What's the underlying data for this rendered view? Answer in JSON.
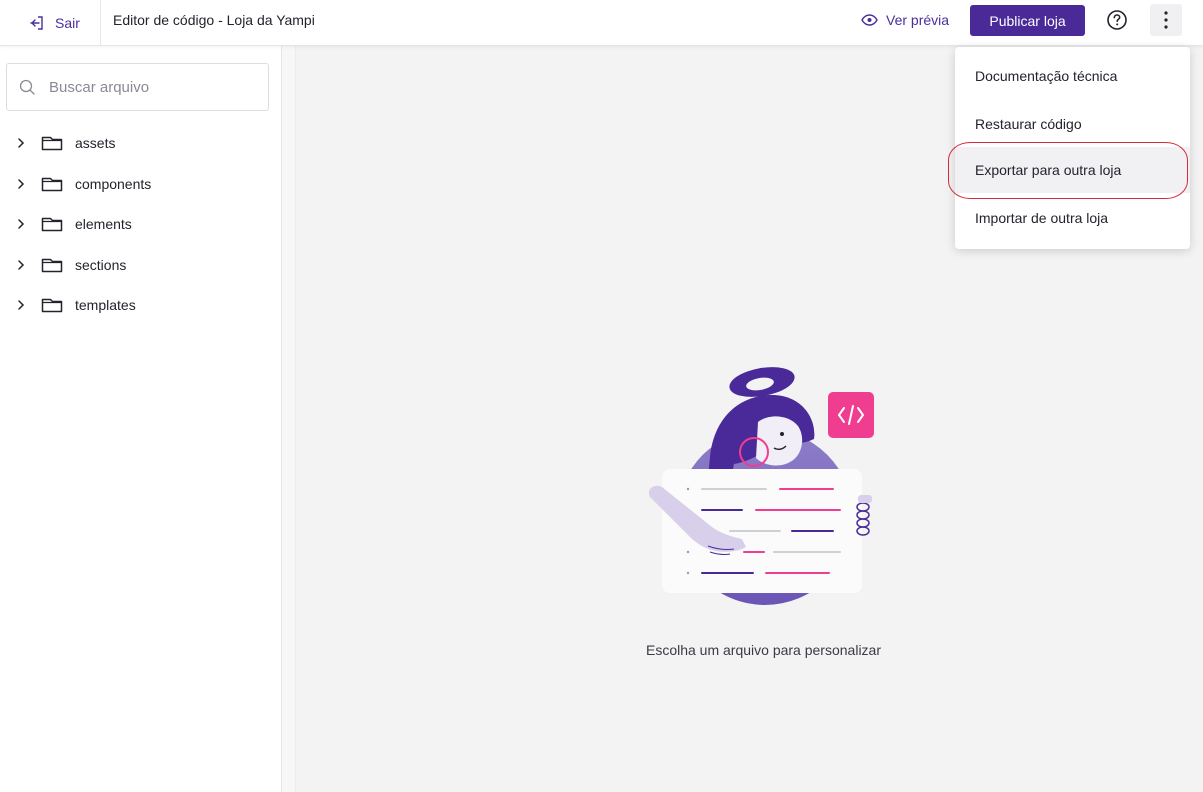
{
  "topbar": {
    "exit_label": "Sair",
    "title": "Editor de código - Loja da Yampi",
    "preview_label": "Ver prévia",
    "publish_label": "Publicar loja"
  },
  "sidebar": {
    "search": {
      "placeholder": "Buscar arquivo",
      "value": ""
    },
    "folders": [
      {
        "label": "assets"
      },
      {
        "label": "components"
      },
      {
        "label": "elements"
      },
      {
        "label": "sections"
      },
      {
        "label": "templates"
      }
    ]
  },
  "main": {
    "empty_message": "Escolha um arquivo para personalizar"
  },
  "menu": {
    "items": [
      {
        "label": "Documentação técnica"
      },
      {
        "label": "Restaurar código"
      },
      {
        "label": "Exportar para outra loja"
      },
      {
        "label": "Importar de outra loja"
      }
    ],
    "active_index": 2
  },
  "colors": {
    "brand": "#4a2a98",
    "accent_pink": "#ef3d8f",
    "highlight_ring": "#d62a3a"
  },
  "icons": [
    "exit-icon",
    "eye-icon",
    "help-icon",
    "kebab-icon",
    "search-icon",
    "chevron-right-icon",
    "folder-icon",
    "code-icon"
  ]
}
